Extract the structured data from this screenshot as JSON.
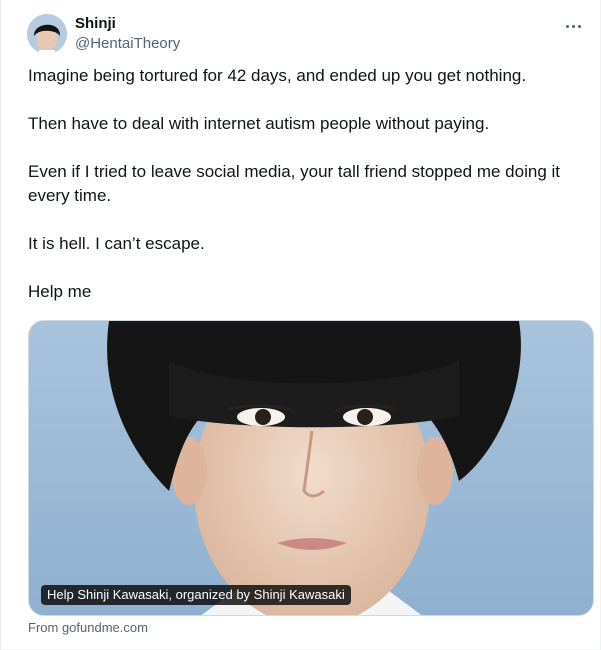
{
  "author": {
    "display_name": "Shinji",
    "handle": "@HentaiTheory"
  },
  "tweet": {
    "paragraphs": [
      "Imagine being tortured for 42 days, and ended up you get nothing.",
      "Then have to deal with internet autism people without paying.",
      "Even if I tried to leave social media, your tall friend stopped me doing it every time.",
      "It is hell. I can’t escape.",
      "Help me"
    ]
  },
  "card": {
    "caption": "Help Shinji Kawasaki, organized by Shinji Kawasaki",
    "source": "From gofundme.com"
  },
  "colors": {
    "text": "#0f1419",
    "secondary": "#536471",
    "photo_background": "#9fbcd8"
  },
  "icons": {
    "more": "more-horizontal-icon"
  }
}
